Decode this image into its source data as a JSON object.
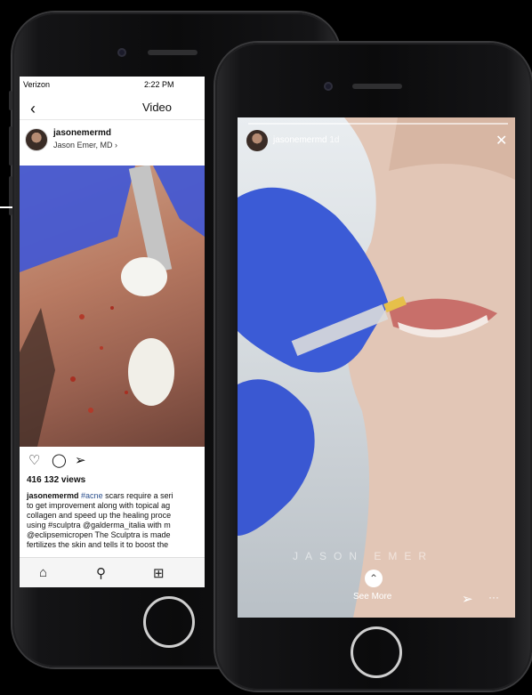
{
  "left_phone": {
    "status": {
      "carrier": "Verizon",
      "time": "2:22 PM"
    },
    "nav": {
      "title": "Video"
    },
    "post": {
      "username": "jasonemermd",
      "subtitle": "Jason Emer, MD ›",
      "views": "416 132 views",
      "caption_user": "jasonemermd",
      "caption_tag1": "#acne",
      "caption_lines": [
        "scars require a seri",
        "to get improvement along with topical ag",
        "collagen and speed up the healing proce",
        "using #sculptra @galderma_italia with m",
        "@eclipsemicropen The Sculptra is made",
        "fertilizes the skin and tells it to boost the"
      ]
    },
    "icons": [
      "heart-icon",
      "comment-icon",
      "send-icon"
    ],
    "tabbar": [
      "home-icon",
      "search-icon",
      "add-icon"
    ]
  },
  "right_phone": {
    "story": {
      "username": "jasonemermd",
      "time": "1d",
      "watermark": "JASON EMER",
      "see_more": "See More"
    },
    "icons": [
      "close-icon",
      "send-icon",
      "more-icon"
    ]
  }
}
